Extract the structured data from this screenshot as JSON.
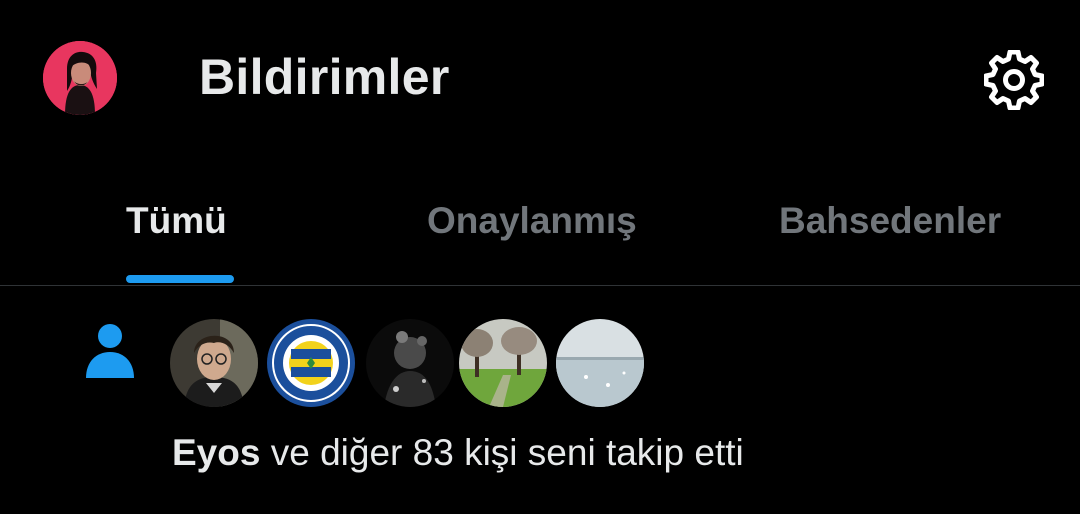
{
  "header": {
    "title": "Bildirimler",
    "avatar_icon": "user-avatar",
    "settings_icon": "gear-icon"
  },
  "tabs": [
    {
      "label": "Tümü",
      "active": true
    },
    {
      "label": "Onaylanmış",
      "active": false
    },
    {
      "label": "Bahsedenler",
      "active": false
    }
  ],
  "notification": {
    "icon": "person-icon",
    "user_name": "Eyos",
    "message": " ve diğer 83 kişi seni takip etti",
    "avatars": [
      "avatar-portrait",
      "avatar-fenerbahce-logo",
      "avatar-dark-photo",
      "avatar-park",
      "avatar-seascape"
    ]
  },
  "colors": {
    "background": "#000000",
    "accent": "#1d9bf0",
    "primary_text": "#e7e9ea",
    "secondary_text": "#71767b",
    "divider": "#2f3336"
  }
}
